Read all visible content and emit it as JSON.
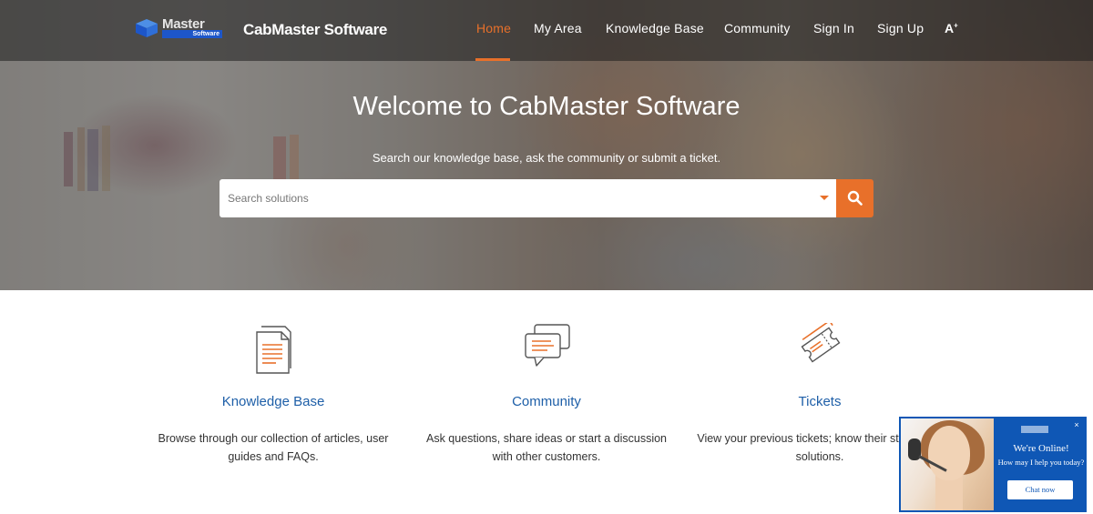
{
  "header": {
    "logo_text": "Master",
    "logo_sub": "Software",
    "brand_name": "CabMaster Software",
    "nav": [
      {
        "label": "Home",
        "active": true
      },
      {
        "label": "My Area",
        "active": false
      },
      {
        "label": "Knowledge Base",
        "active": false
      },
      {
        "label": "Community",
        "active": false
      },
      {
        "label": "Sign In",
        "active": false
      },
      {
        "label": "Sign Up",
        "active": false
      }
    ],
    "font_toggle": "A",
    "accent_color": "#e8702a"
  },
  "hero": {
    "title": "Welcome to CabMaster Software",
    "subtitle": "Search our knowledge base, ask the community or submit a ticket.",
    "search_placeholder": "Search solutions",
    "search_icon": "search-icon"
  },
  "features": [
    {
      "icon": "document-icon",
      "title": "Knowledge Base",
      "description": "Browse through our collection of articles, user guides and FAQs."
    },
    {
      "icon": "chat-bubbles-icon",
      "title": "Community",
      "description": "Ask questions, share ideas or start a discussion with other customers."
    },
    {
      "icon": "ticket-icon",
      "title": "Tickets",
      "description": "View your previous tickets; know their status and solutions."
    }
  ],
  "chat": {
    "status": "We're Online!",
    "prompt": "How may I help you today?",
    "button": "Chat now",
    "brand_color": "#0f57b5"
  }
}
